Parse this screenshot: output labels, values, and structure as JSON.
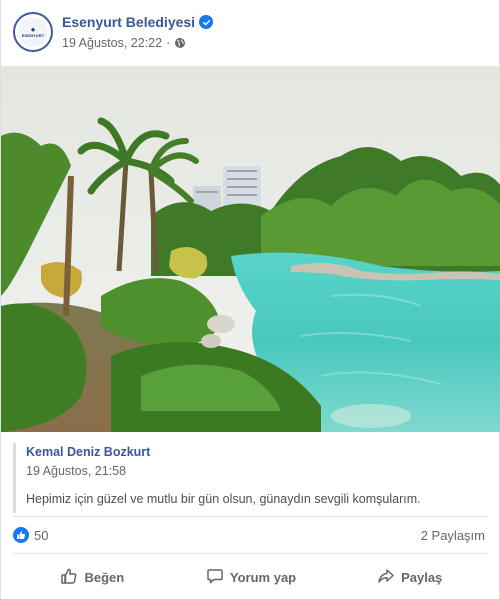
{
  "post": {
    "page_name": "Esenyurt Belediyesi",
    "verified": true,
    "avatar_text": "ESENYURT",
    "date": "19 Ağustos, 22:22",
    "separator": "·",
    "audience_icon": "globe-icon"
  },
  "photo": {
    "scene": "park-pond",
    "colors": {
      "water": "#4fd0c8",
      "sky": "#e9ece6",
      "foliage": "#4c8a2c"
    }
  },
  "shared": {
    "author": "Kemal Deniz Bozkurt",
    "time": "19 Ağustos, 21:58",
    "text": "Hepimiz için güzel ve mutlu bir gün olsun, günaydın sevgili komşularım."
  },
  "reactions": {
    "like_icon": "like-reaction-icon",
    "count": "50",
    "shares": "2 Paylaşım"
  },
  "actions": {
    "like": {
      "label": "Beğen",
      "icon": "thumbs-up-icon"
    },
    "comment": {
      "label": "Yorum yap",
      "icon": "comment-icon"
    },
    "share": {
      "label": "Paylaş",
      "icon": "share-icon"
    }
  },
  "colors": {
    "brand": "#385898",
    "accent": "#1877f2",
    "muted": "#65676b"
  }
}
